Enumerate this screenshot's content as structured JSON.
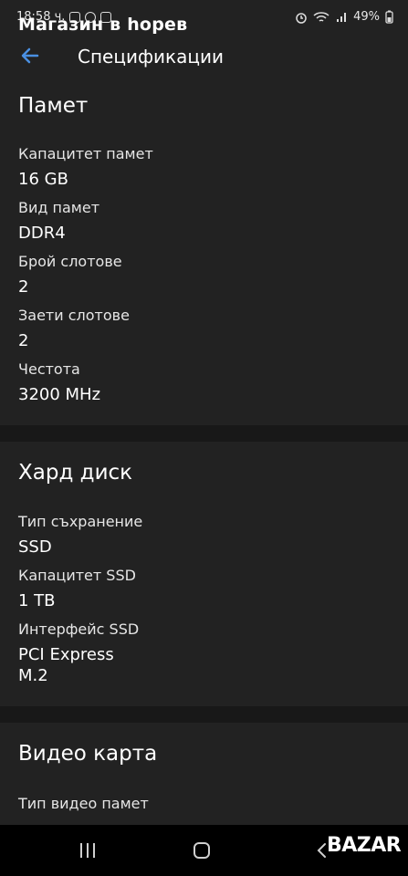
{
  "status": {
    "time": "18:58 ч.",
    "battery": "49%"
  },
  "header": {
    "shop_title": "Магазин в   hopeв   ",
    "back_label": "←",
    "title": "Спецификации"
  },
  "sections": [
    {
      "title": "Памет",
      "fields": [
        {
          "label": "Капацитет памет",
          "value": "16 GB"
        },
        {
          "label": "Вид памет",
          "value": "DDR4"
        },
        {
          "label": "Брой слотове",
          "value": "2"
        },
        {
          "label": "Заети слотове",
          "value": "2"
        },
        {
          "label": "Честота",
          "value": "3200 MHz"
        }
      ]
    },
    {
      "title": "Хард диск",
      "fields": [
        {
          "label": "Тип съхранение",
          "value": "SSD"
        },
        {
          "label": "Капацитет SSD",
          "value": "1 TB"
        },
        {
          "label": "Интерфейс SSD",
          "value": "PCI Express M.2"
        }
      ]
    },
    {
      "title": "Видео карта",
      "fields": [
        {
          "label": "Тип видео памет",
          "value": ""
        }
      ]
    }
  ],
  "watermark": "BAZAR",
  "colors": {
    "background": "#222222",
    "divider": "#181818",
    "accent": "#4a90e2",
    "navbar": "#000000"
  }
}
